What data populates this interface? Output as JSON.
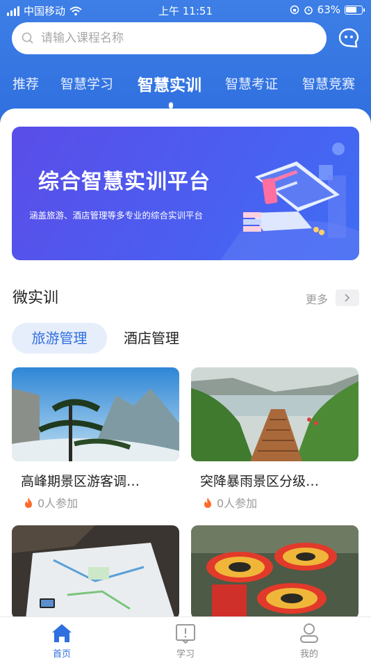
{
  "status_bar": {
    "carrier": "中国移动",
    "time": "上午 11:51",
    "battery": "63%"
  },
  "search": {
    "placeholder": "请输入课程名称"
  },
  "top_tabs": [
    "推荐",
    "智慧学习",
    "智慧实训",
    "智慧考证",
    "智慧竞赛"
  ],
  "active_tab_index": 2,
  "banner": {
    "title": "综合智慧实训平台",
    "subtitle": "涵盖旅游、酒店管理等多专业的综合实训平台"
  },
  "section": {
    "title": "微实训",
    "more_label": "更多"
  },
  "categories": [
    "旅游管理",
    "酒店管理"
  ],
  "active_category_index": 0,
  "cards": [
    {
      "title": "高峰期景区游客调…",
      "joined": "0人参加"
    },
    {
      "title": "突降暴雨景区分级…",
      "joined": "0人参加"
    },
    {
      "title": "",
      "joined": ""
    },
    {
      "title": "",
      "joined": ""
    }
  ],
  "bottom_nav": [
    {
      "label": "首页",
      "icon": "home-icon",
      "active": true
    },
    {
      "label": "学习",
      "icon": "book-icon",
      "active": false
    },
    {
      "label": "我的",
      "icon": "user-icon",
      "active": false
    }
  ],
  "colors": {
    "primary": "#2f6fdf",
    "header": "#3d7fe6",
    "banner": "#4b5ef0"
  }
}
